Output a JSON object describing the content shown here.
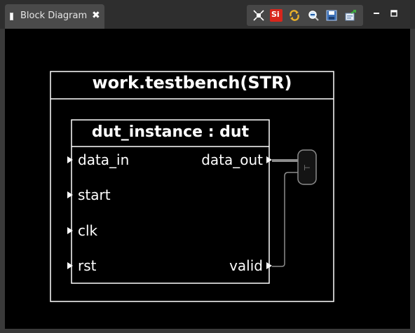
{
  "tab": {
    "title": "Block Diagram",
    "close_glyph": "✖",
    "icon": "diagram-file-icon"
  },
  "toolbar": {
    "buttons": [
      {
        "name": "fit-view-icon"
      },
      {
        "name": "si-toggle-icon",
        "text": "Si"
      },
      {
        "name": "refresh-icon"
      },
      {
        "name": "zoom-icon"
      },
      {
        "name": "save-icon"
      },
      {
        "name": "export-icon"
      }
    ]
  },
  "window_controls": {
    "minimize": "minimize-icon",
    "maximize": "maximize-icon"
  },
  "diagram": {
    "top_entity": "work.testbench(STR)",
    "instance": "dut_instance : dut",
    "inputs": [
      "data_in",
      "start",
      "clk",
      "rst"
    ],
    "outputs": [
      "data_out",
      "valid"
    ],
    "tap_glyph": "⊢"
  },
  "colors": {
    "canvas": "#000000",
    "frame_bg": "#3a3a3a",
    "tab_bg": "#4a4a4a",
    "toolbar_bg": "#474747",
    "line": "#ffffff",
    "bus": "#8c8c8c",
    "si_red": "#d8261c"
  }
}
